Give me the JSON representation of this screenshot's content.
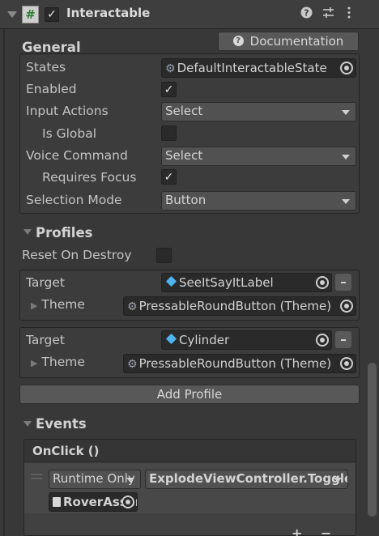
{
  "header": {
    "title": "Interactable",
    "help_icon": "help-icon",
    "preset_icon": "preset-icon",
    "menu_icon": "kebab-menu-icon",
    "enabled_mark": "✓"
  },
  "general": {
    "title": "General",
    "doc_button": "Documentation",
    "rows": {
      "states_label": "States",
      "states_value": "DefaultInteractableState",
      "enabled_label": "Enabled",
      "enabled_value": "✓",
      "input_actions_label": "Input Actions",
      "input_actions_value": "Select",
      "is_global_label": "Is Global",
      "voice_command_label": "Voice Command",
      "voice_command_value": "Select",
      "requires_focus_label": "Requires Focus",
      "requires_focus_value": "✓",
      "selection_mode_label": "Selection Mode",
      "selection_mode_value": "Button"
    }
  },
  "profiles": {
    "title": "Profiles",
    "reset_label": "Reset On Destroy",
    "items": [
      {
        "target_label": "Target",
        "target_value": "SeeItSayItLabel",
        "theme_label": "Theme",
        "theme_value": "PressableRoundButton (Theme)"
      },
      {
        "target_label": "Target",
        "target_value": "Cylinder",
        "theme_label": "Theme",
        "theme_value": "PressableRoundButton (Theme)"
      }
    ],
    "remove_label": "–",
    "add_button": "Add Profile"
  },
  "events": {
    "title": "Events",
    "onclick_label": "OnClick ()",
    "runtime_value": "Runtime Only",
    "function_value": "ExplodeViewController.ToggleExplodedView",
    "object_value": "RoverAssembly",
    "add_label": "+",
    "remove_label": "−"
  },
  "colors": {
    "background": "#383838",
    "header": "#3e3e3e",
    "field": "#2a2a2a",
    "dropdown": "#515151",
    "object_icon": "#4fb3ee"
  }
}
